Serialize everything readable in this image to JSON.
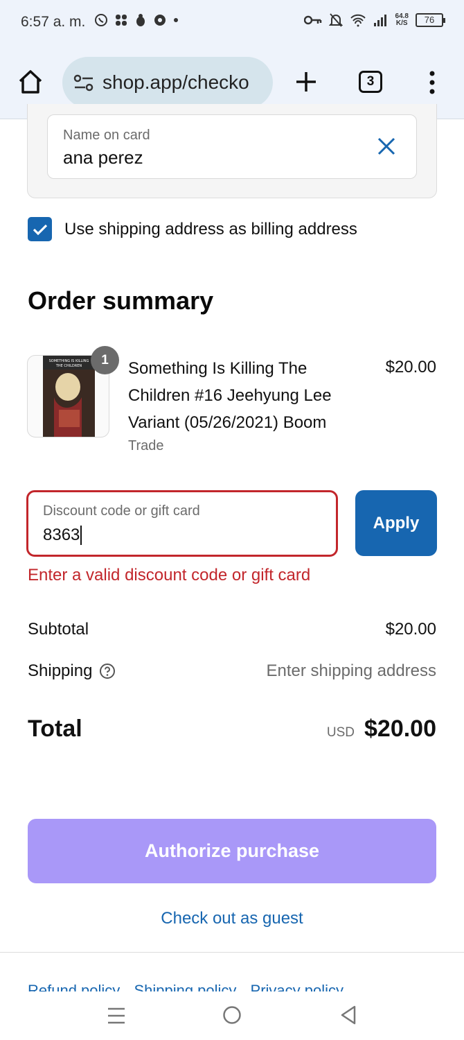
{
  "status_bar": {
    "time": "6:57 a. m.",
    "net_speed_value": "64.8",
    "net_speed_unit": "K/S",
    "battery": "76"
  },
  "browser": {
    "url": "shop.app/checko",
    "tab_count": "3"
  },
  "payment": {
    "name_label": "Name on card",
    "name_value": "ana perez",
    "billing_checkbox_label": "Use shipping address as billing address"
  },
  "order_summary": {
    "title": "Order summary",
    "item": {
      "quantity": "1",
      "name": "Something Is Killing The Children #16 Jeehyung Lee Variant (05/26/2021) Boom",
      "variant": "Trade",
      "price": "$20.00",
      "cover_text": "SOMETHING IS KILLING THE CHILDREN"
    },
    "discount": {
      "placeholder": "Discount code or gift card",
      "value": "8363",
      "apply_label": "Apply",
      "error": "Enter a valid discount code or gift card"
    },
    "subtotal_label": "Subtotal",
    "subtotal_value": "$20.00",
    "shipping_label": "Shipping",
    "shipping_value": "Enter shipping address",
    "total_label": "Total",
    "total_currency": "USD",
    "total_value": "$20.00"
  },
  "actions": {
    "authorize_label": "Authorize purchase",
    "guest_label": "Check out as guest"
  },
  "footer_links": [
    "Refund policy",
    "Shipping policy",
    "Privacy policy"
  ],
  "colors": {
    "accent_blue": "#1766b0",
    "error_red": "#c2262b",
    "authorize_purple": "#a998f8"
  }
}
